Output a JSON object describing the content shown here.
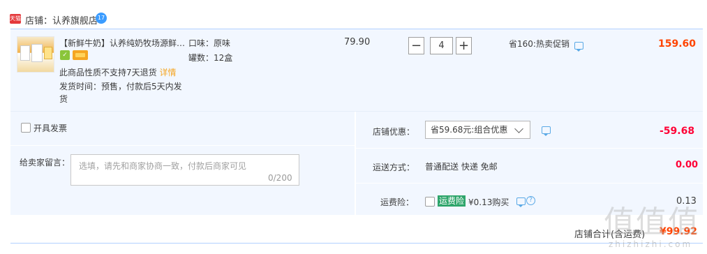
{
  "store": {
    "badge": "天猫",
    "label": "店铺：认养旗舰店",
    "chat_badge": "17"
  },
  "item": {
    "title": "【新鲜牛奶】认养纯奶牧场源鲜…",
    "no_return": "此商品性质不支持7天退货",
    "detail_link": "详情",
    "ship_time": "发货时间：预售，付款后5天内发货",
    "sku": [
      "口味：原味",
      "罐数：12盒"
    ],
    "price": "79.90",
    "qty_minus": "−",
    "qty_value": "4",
    "qty_plus": "+",
    "promo": "省160:热卖促销",
    "subtotal": "159.60"
  },
  "invoice": {
    "label": "开具发票"
  },
  "note": {
    "label": "给卖家留言：",
    "placeholder": "选填，请先和商家协商一致，付款后商家可见",
    "count": "0/200"
  },
  "discount": {
    "label": "店铺优惠：",
    "selected": "省59.68元:组合优惠",
    "value": "-59.68"
  },
  "shipping": {
    "label": "运送方式：",
    "method": "普通配送 快递 免邮",
    "value": "0.00"
  },
  "insurance": {
    "label": "运费险：",
    "tag": "运费险",
    "text": "¥0.13购买",
    "help": "?",
    "value": "0.13"
  },
  "total": {
    "label": "店铺合计(含运费)",
    "value": "¥99.92"
  },
  "watermark": {
    "main": "值值值",
    "sub": "zhizhizhi.com"
  },
  "colors": {
    "accent_price": "#ff4400",
    "accent_red": "#ff0036",
    "panel_bg": "#f2f7ff",
    "border_blue": "#b2d1ff",
    "insurance_green": "#2ea56b"
  }
}
